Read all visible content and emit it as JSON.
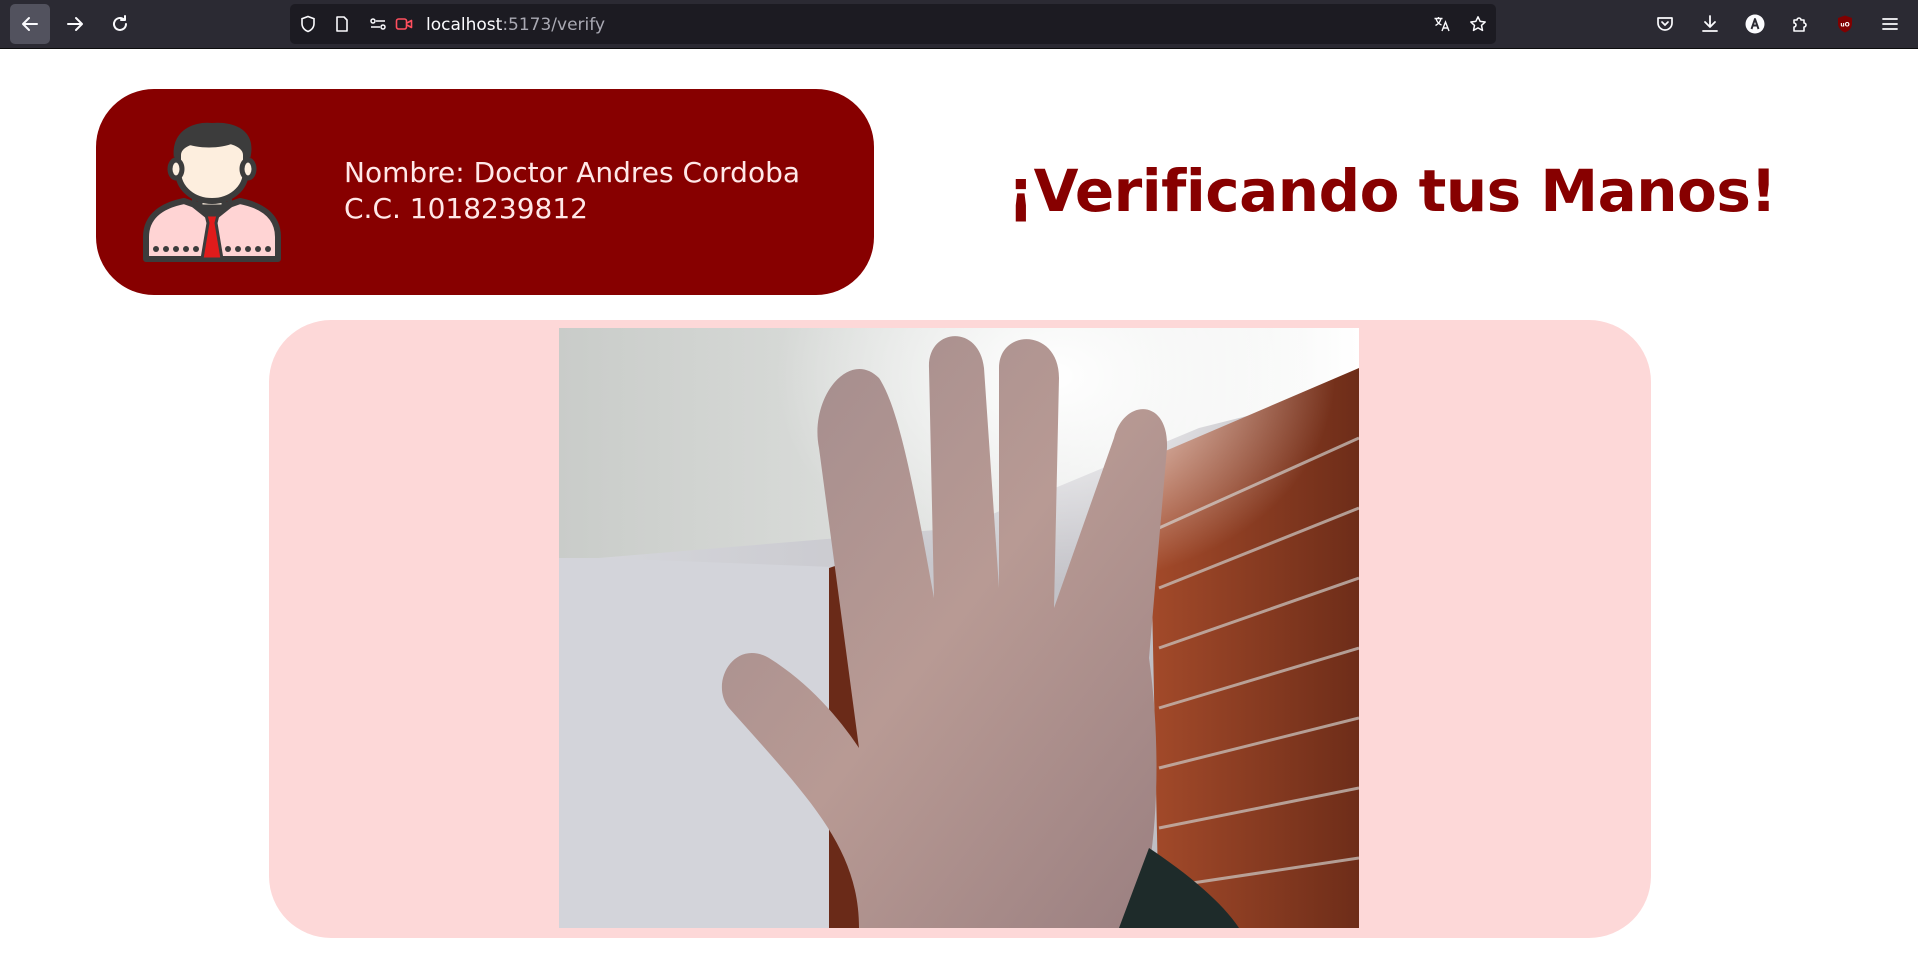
{
  "browser": {
    "url_host": "localhost",
    "url_rest": ":5173/verify"
  },
  "profile": {
    "name_line": "Nombre: Doctor Andres Cordoba",
    "id_line": "C.C. 1018239812"
  },
  "headline": "¡Verificando tus Manos!",
  "colors": {
    "accent": "#870000",
    "panel_bg": "#fdd8d8"
  },
  "icons": {
    "avatar": "doctor-avatar-icon"
  }
}
